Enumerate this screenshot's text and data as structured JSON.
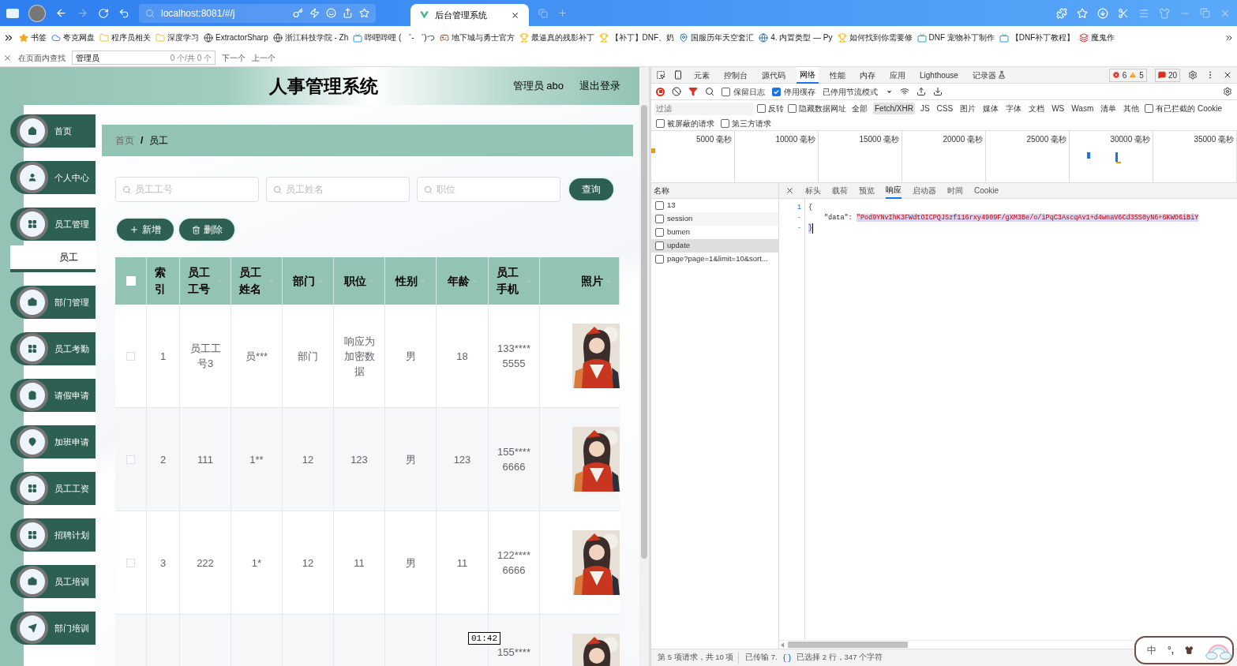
{
  "browser": {
    "address": "localhost:8081/#/j",
    "tab_title": "后台管理系统",
    "bookmarks": [
      "书签",
      "夸克网盘",
      "程序员相关",
      "深度学习",
      "ExtractorSharp",
      "浙江科技学院 - Zh",
      "哔哩哔哩 ( ゜- ゜)つ",
      "地下城与勇士官方",
      "最逼真的残影补丁",
      "【补丁】DNF、奶",
      "国服历年天空套汇",
      "4. 内置类型 — Py",
      "如何找到你需要修",
      "DNF 宠物补丁制作",
      "【DNF补丁教程】",
      "魔鬼作"
    ],
    "find_bar": {
      "label": "在页面内查找",
      "value": "管理员",
      "count": "0 个/共 0 个",
      "next": "下一个",
      "previous": "上一个"
    }
  },
  "app": {
    "title": "人事管理系统",
    "user": "管理员 abo",
    "logout": "退出登录",
    "sidebar": [
      {
        "label": "首页",
        "selected": false
      },
      {
        "label": "个人中心",
        "selected": false
      },
      {
        "label": "员工管理",
        "selected": false,
        "expanded": true,
        "children": [
          {
            "label": "员工",
            "selected": true
          }
        ]
      },
      {
        "label": "部门管理",
        "selected": false
      },
      {
        "label": "员工考勤",
        "selected": false
      },
      {
        "label": "请假申请",
        "selected": false
      },
      {
        "label": "加班申请",
        "selected": false
      },
      {
        "label": "员工工资",
        "selected": false
      },
      {
        "label": "招聘计划",
        "selected": false
      },
      {
        "label": "员工培训",
        "selected": false
      },
      {
        "label": "部门培训",
        "selected": false
      }
    ],
    "breadcrumb": [
      "首页",
      "员工"
    ],
    "breadcrumb_separator": "/",
    "search_fields": [
      {
        "placeholder": "员工工号"
      },
      {
        "placeholder": "员工姓名"
      },
      {
        "placeholder": "职位"
      }
    ],
    "search_button": "查询",
    "add_button": "新增",
    "delete_button": "删除",
    "table": {
      "all_checked": false,
      "columns": [
        "索引",
        "员工工号",
        "员工姓名",
        "部门",
        "职位",
        "性别",
        "年龄",
        "员工手机",
        "照片"
      ],
      "rows": [
        {
          "checked": false,
          "cells": [
            "1",
            "员工工号3",
            "员***",
            "部门",
            "响应为加密数据",
            "男",
            "18",
            "133****5555"
          ],
          "photo": true
        },
        {
          "checked": false,
          "cells": [
            "2",
            "111",
            "1**",
            "12",
            "123",
            "男",
            "123",
            "155****6666"
          ],
          "photo": true
        },
        {
          "checked": false,
          "cells": [
            "3",
            "222",
            "1*",
            "12",
            "11",
            "男",
            "11",
            "122****6666"
          ],
          "photo": true
        },
        {
          "cells": [
            "",
            "",
            "",
            "",
            "",
            "",
            "",
            "155****"
          ],
          "photo": true
        }
      ]
    },
    "time_tooltip": "01:42"
  },
  "devtools": {
    "tabs": [
      {
        "label": "元素",
        "selected": false
      },
      {
        "label": "控制台",
        "selected": false
      },
      {
        "label": "源代码",
        "selected": false
      },
      {
        "label": "网络",
        "selected": true
      },
      {
        "label": "性能",
        "selected": false
      },
      {
        "label": "内存",
        "selected": false
      },
      {
        "label": "应用",
        "selected": false
      },
      {
        "label": "Lighthouse",
        "selected": false
      },
      {
        "label": "记录器",
        "selected": false
      }
    ],
    "errors": "6",
    "warnings": "5",
    "messages": "20",
    "toolbar": {
      "preserve_log": {
        "label": "保留日志",
        "checked": false
      },
      "disable_cache": {
        "label": "停用缓存",
        "checked": true
      },
      "throttling": "已停用节流模式"
    },
    "filter": {
      "placeholder": "过滤",
      "invert": {
        "label": "反转",
        "checked": false
      },
      "hide_data_urls": {
        "label": "隐藏数据网址",
        "checked": false
      },
      "types": [
        {
          "label": "全部",
          "selected": false
        },
        {
          "label": "Fetch/XHR",
          "selected": true
        },
        {
          "label": "JS",
          "selected": false
        },
        {
          "label": "CSS",
          "selected": false
        },
        {
          "label": "图片",
          "selected": false
        },
        {
          "label": "媒体",
          "selected": false
        },
        {
          "label": "字体",
          "selected": false
        },
        {
          "label": "文档",
          "selected": false
        },
        {
          "label": "WS",
          "selected": false
        },
        {
          "label": "Wasm",
          "selected": false
        },
        {
          "label": "清单",
          "selected": false
        },
        {
          "label": "其他",
          "selected": false
        }
      ],
      "blocked_cookies": {
        "label": "有已拦截的 Cookie",
        "checked": false
      },
      "blocked_requests": {
        "label": "被屏蔽的请求",
        "checked": false
      },
      "third_party": {
        "label": "第三方请求",
        "checked": false
      }
    },
    "timeline_ticks": [
      "5000 毫秒",
      "10000 毫秒",
      "15000 毫秒",
      "20000 毫秒",
      "25000 毫秒",
      "30000 毫秒",
      "35000 毫秒"
    ],
    "name_header": "名称",
    "requests": [
      {
        "name": "13",
        "selected": false
      },
      {
        "name": "session",
        "selected": false
      },
      {
        "name": "bumen",
        "selected": false
      },
      {
        "name": "update",
        "selected": true
      },
      {
        "name": "page?page=1&limit=10&sort...",
        "selected": false
      }
    ],
    "detail_tabs": [
      {
        "label": "标头",
        "selected": false
      },
      {
        "label": "载荷",
        "selected": false
      },
      {
        "label": "预览",
        "selected": false
      },
      {
        "label": "响应",
        "selected": true
      },
      {
        "label": "启动器",
        "selected": false
      },
      {
        "label": "时间",
        "selected": false
      },
      {
        "label": "Cookie",
        "selected": false
      }
    ],
    "code_lines": [
      {
        "number": "1",
        "text": "{"
      },
      {
        "number": "-",
        "key": "\"data\": ",
        "value": "\"Pod9YNvIhK3FWdtOICPQJSzf116rxy4909F/gXM3Be/o/iPqC3AscqAv1+d4wnaV6Cd35S0yN6+6KWO6iBiY"
      },
      {
        "number": "-",
        "text": "}"
      }
    ],
    "status": {
      "requests": "第 5 项请求，共 10 项",
      "transferred": "已传输 7.",
      "selection": "已选择 2 行，347 个字符"
    }
  },
  "ime": {
    "mode": "中",
    "punctuation": "°,"
  }
}
